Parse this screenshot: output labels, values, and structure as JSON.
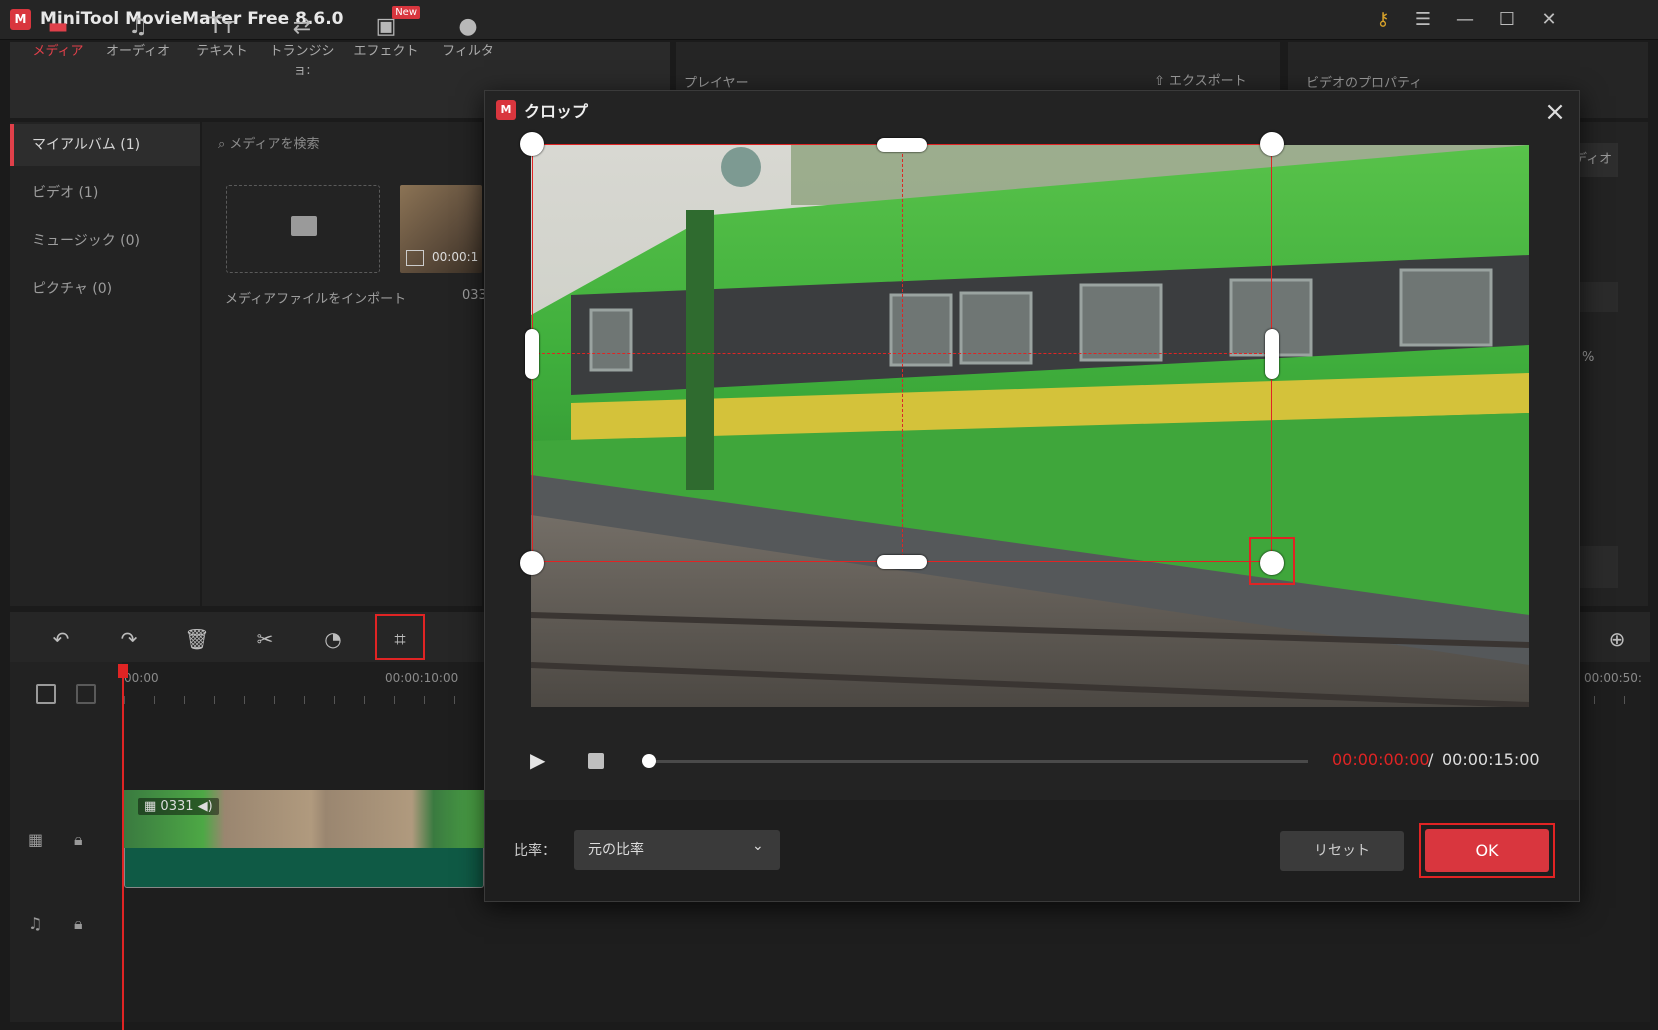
{
  "app": {
    "title": "MiniTool MovieMaker Free 8.6.0",
    "logo_text": "M"
  },
  "toolbar": {
    "items": [
      {
        "label": "メディア",
        "icon": "folder-icon",
        "glyph": "▬"
      },
      {
        "label": "オーディオ",
        "icon": "music-note-icon",
        "glyph": "♫"
      },
      {
        "label": "テキスト",
        "icon": "text-icon",
        "glyph": "Tт"
      },
      {
        "label": "トランジショ:",
        "icon": "transition-icon",
        "glyph": "⇄"
      },
      {
        "label": "エフェクト",
        "icon": "effect-icon",
        "glyph": "▣",
        "badge": "New"
      },
      {
        "label": "フィルタ",
        "icon": "filter-icon",
        "glyph": "●"
      },
      {
        "label": "",
        "icon": "elements-icon",
        "glyph": "★",
        "badge": "New"
      },
      {
        "label": "",
        "icon": "motion-icon",
        "glyph": "◐"
      }
    ]
  },
  "player": {
    "title": "プレイヤー",
    "export_label": "エクスポート"
  },
  "properties": {
    "title": "ビデオのプロパティ",
    "tab": "ディオ",
    "percent": "%"
  },
  "sidebar": {
    "items": [
      {
        "label": "マイアルバム (1)"
      },
      {
        "label": "ビデオ (1)"
      },
      {
        "label": "ミュージック (0)"
      },
      {
        "label": "ピクチャ (0)"
      }
    ]
  },
  "media": {
    "search_placeholder": "メディアを検索",
    "import_label": "メディアファイルをインポート",
    "thumb_time": "00:00:1",
    "thumb_name": "033"
  },
  "timeline": {
    "ruler": [
      "00:00",
      "00:00:10:00",
      "00:00:50:"
    ],
    "clip_label": "0331"
  },
  "dialog": {
    "title": "クロップ",
    "time_current": "00:00:00:00",
    "time_separator": "/",
    "time_total": "00:00:15:00",
    "ratio_label": "比率：",
    "ratio_value": "元の比率",
    "reset_label": "リセット",
    "ok_label": "OK",
    "playback_progress": 0
  },
  "colors": {
    "accent": "#e02424",
    "brand": "#d9363e",
    "background": "#1b1b1b"
  }
}
